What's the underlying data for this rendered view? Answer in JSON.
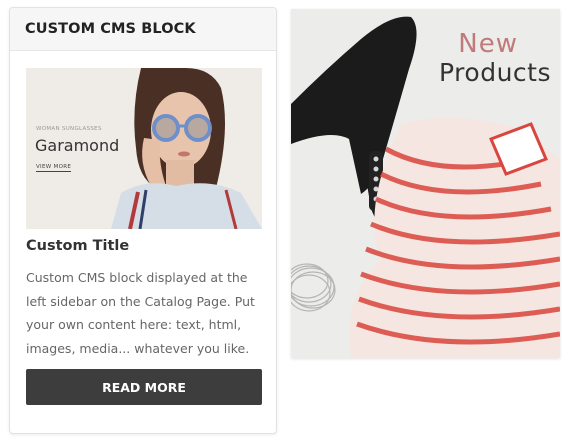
{
  "cms_block": {
    "title": "CUSTOM CMS BLOCK",
    "banner": {
      "small_label": "WOMAN SUNGLASSES",
      "title": "Garamond",
      "link": "VIEW MORE"
    },
    "custom_title": "Custom Title",
    "body": "Custom CMS block displayed at the left sidebar on the Catalog Page. Put your own content here: text, html, images, media... whatever you like.",
    "button_label": "READ MORE"
  },
  "promo_banner": {
    "line1": "New",
    "line2": "Products"
  },
  "colors": {
    "button_bg": "#3d3d3d",
    "header_bg": "#f6f6f6",
    "accent_new": "#c07a7a"
  }
}
